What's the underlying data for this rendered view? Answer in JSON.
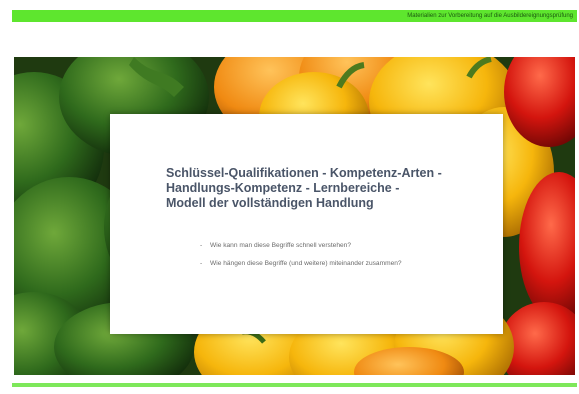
{
  "header": {
    "strip_text": "Materialien zur Vorbereitung auf die Ausbildereignungsprüfung",
    "accent_color": "#5ee62e"
  },
  "hero": {
    "image_subject": "green, yellow and red bell peppers"
  },
  "slide": {
    "headline_lines": [
      "Schlüssel-Qualifikationen   -   Kompetenz-Arten  -",
      "Handlungs-Kompetenz       -   Lernbereiche  -",
      "Modell der vollständigen Handlung"
    ],
    "headline_color": "#4a5568",
    "bullet_marker": "-",
    "bullets": [
      "Wie kann man diese Begriffe schnell verstehen?",
      "Wie hängen diese Begriffe (und weitere) miteinander zusammen?"
    ]
  }
}
